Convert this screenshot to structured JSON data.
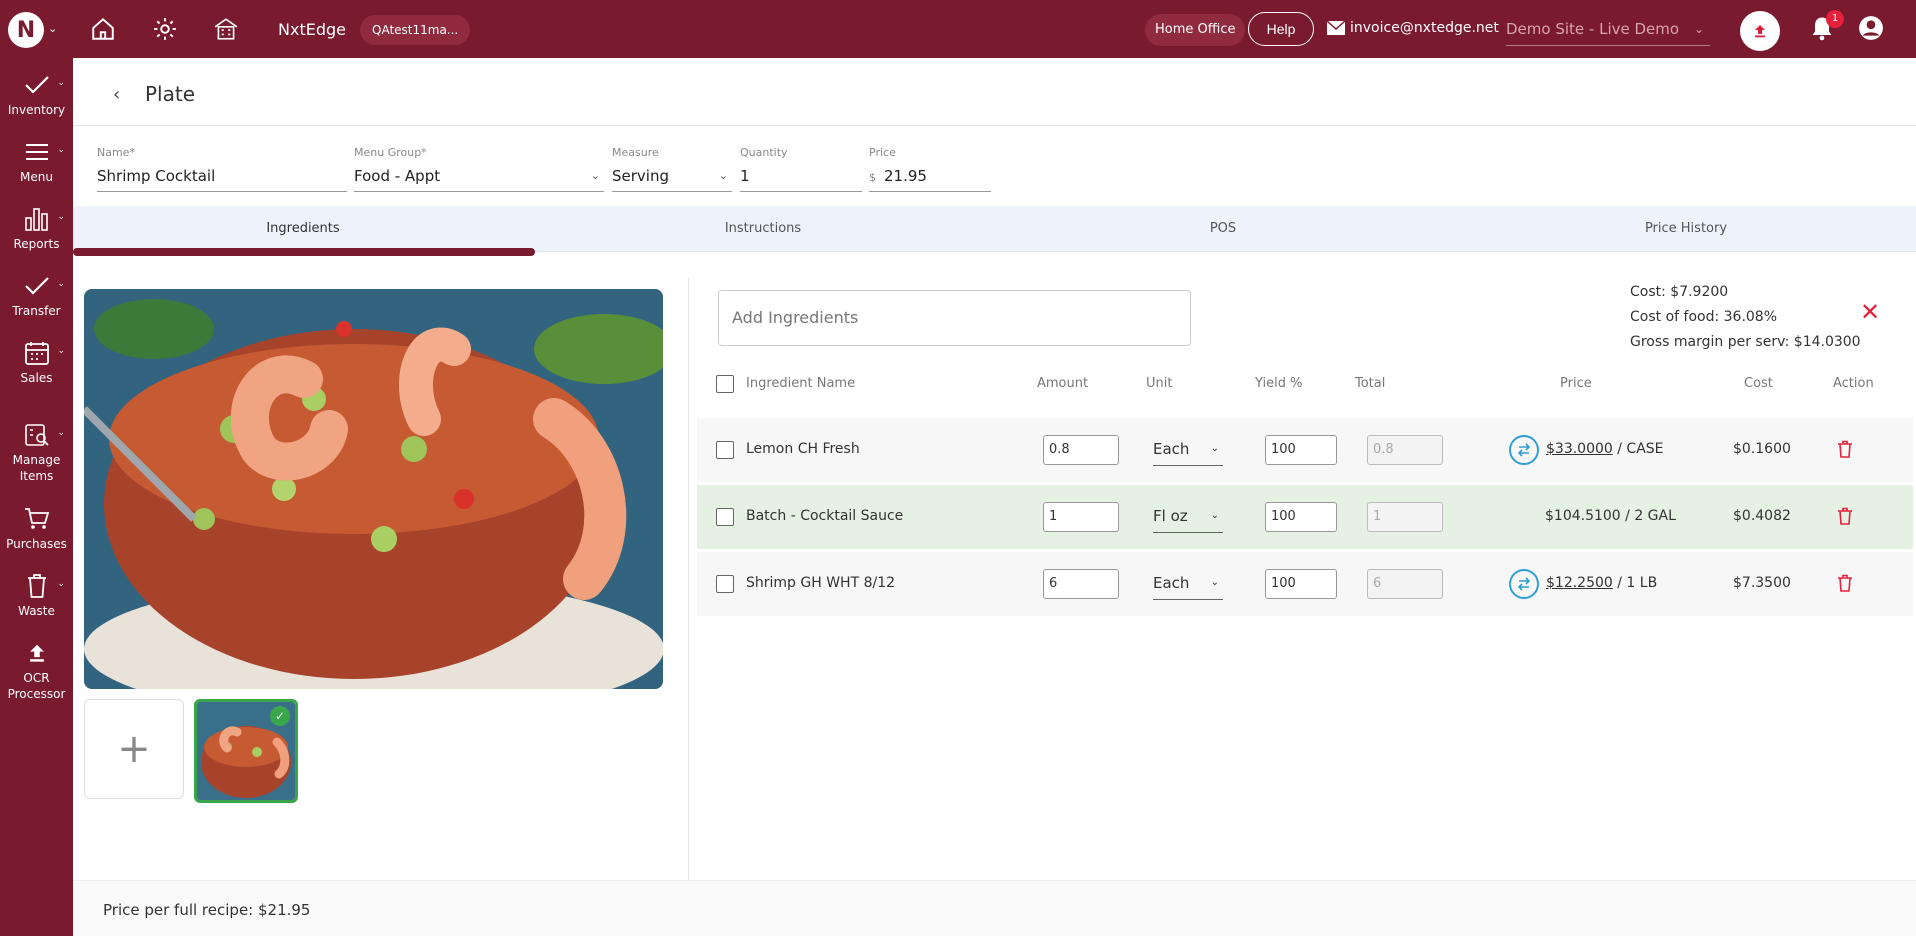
{
  "topbar": {
    "brand": "NxtEdge",
    "account": "QAtest11ma...",
    "office": "Home Office",
    "help": "Help",
    "email": "invoice@nxtedge.net",
    "site": "Demo Site - Live Demo",
    "notification_count": "1",
    "icons": [
      "home-icon",
      "gear-icon",
      "building-icon",
      "upload-icon",
      "bell-icon",
      "user-icon",
      "mail-icon"
    ],
    "accent": "#7a1a2e"
  },
  "sidebar": {
    "items": [
      {
        "label": "Inventory",
        "icon": "check-icon"
      },
      {
        "label": "Menu",
        "icon": "hamburger-icon"
      },
      {
        "label": "Reports",
        "icon": "bar-chart-icon"
      },
      {
        "label": "Transfer",
        "icon": "check-icon"
      },
      {
        "label": "Sales",
        "icon": "calendar-icon"
      },
      {
        "label": "Manage\nItems",
        "icon": "search-list-icon"
      },
      {
        "label": "Purchases",
        "icon": "cart-icon"
      },
      {
        "label": "Waste",
        "icon": "trash-icon"
      },
      {
        "label": "OCR\nProcessor",
        "icon": "upload-icon"
      }
    ]
  },
  "page": {
    "title": "Plate"
  },
  "form": {
    "name_label": "Name*",
    "name_value": "Shrimp Cocktail",
    "group_label": "Menu Group*",
    "group_value": "Food - Appt",
    "measure_label": "Measure",
    "measure_value": "Serving",
    "quantity_label": "Quantity",
    "quantity_value": "1",
    "price_label": "Price",
    "price_currency": "$",
    "price_value": "21.95"
  },
  "tabs": [
    "Ingredients",
    "Instructions",
    "POS",
    "Price History"
  ],
  "ingredients": {
    "add_placeholder": "Add Ingredients",
    "summary": {
      "cost": "Cost: $7.9200",
      "cost_of_food": "Cost of food: 36.08%",
      "gross_margin": "Gross margin per serv: $14.0300"
    },
    "headers": {
      "name": "Ingredient Name",
      "amount": "Amount",
      "unit": "Unit",
      "yield": "Yield %",
      "total": "Total",
      "price": "Price",
      "cost": "Cost",
      "action": "Action"
    },
    "rows": [
      {
        "name": "Lemon CH Fresh",
        "amount": "0.8",
        "unit": "Each",
        "yield": "100",
        "total": "0.8",
        "price": "$33.0000",
        "price_unit": "/ CASE",
        "cost": "$0.1600"
      },
      {
        "name": "Batch - Cocktail Sauce",
        "amount": "1",
        "unit": "Fl oz",
        "yield": "100",
        "total": "1",
        "price": "$104.5100 / 2 GAL",
        "price_unit": "",
        "cost": "$0.4082"
      },
      {
        "name": "Shrimp GH WHT 8/12",
        "amount": "6",
        "unit": "Each",
        "yield": "100",
        "total": "6",
        "price": "$12.2500",
        "price_unit": "/ 1 LB",
        "cost": "$7.3500"
      }
    ]
  },
  "footer": {
    "text": "Price per full recipe: $21.95"
  }
}
